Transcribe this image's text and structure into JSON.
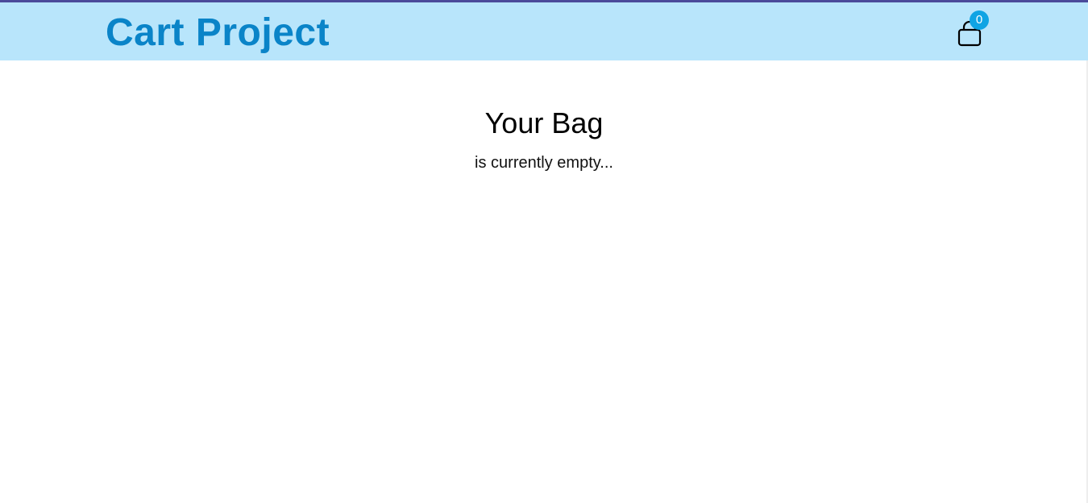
{
  "navbar": {
    "brand": "Cart Project",
    "cart_count": "0",
    "cart_icon": "shopping-bag-icon"
  },
  "bag": {
    "title": "Your Bag",
    "subtitle": "is currently empty..."
  },
  "colors": {
    "navbar_bg": "#b8e5fb",
    "brand_text": "#0a84c8",
    "badge_bg": "#0fa4e4"
  }
}
